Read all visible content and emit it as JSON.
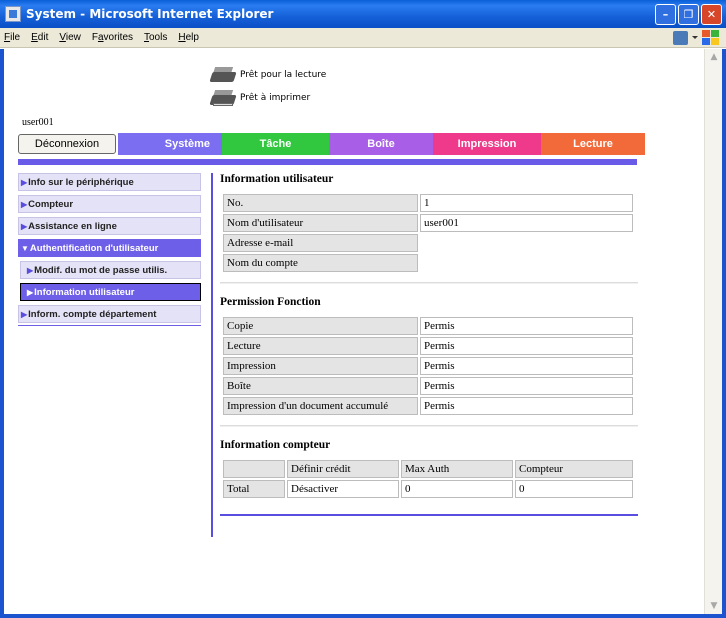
{
  "window": {
    "title": "System - Microsoft Internet Explorer",
    "controls": [
      "minimize",
      "maximize",
      "close"
    ]
  },
  "menubar": {
    "items": [
      {
        "pre": "",
        "key": "F",
        "post": "ile"
      },
      {
        "pre": "",
        "key": "E",
        "post": "dit"
      },
      {
        "pre": "",
        "key": "V",
        "post": "iew"
      },
      {
        "pre": "F",
        "key": "a",
        "post": "vorites"
      },
      {
        "pre": "",
        "key": "T",
        "post": "ools"
      },
      {
        "pre": "",
        "key": "H",
        "post": "elp"
      }
    ]
  },
  "status": {
    "scan": "Prêt pour la lecture",
    "print": "Prêt à imprimer"
  },
  "user": "user001",
  "tabs": {
    "logout": "Déconnexion",
    "systeme": "Système",
    "tache": "Tâche",
    "boite": "Boîte",
    "impression": "Impression",
    "lecture": "Lecture"
  },
  "sidebar": {
    "items": [
      {
        "label": "Info sur le périphérique"
      },
      {
        "label": "Compteur"
      },
      {
        "label": "Assistance en ligne"
      },
      {
        "label": "Authentification d'utilisateur"
      },
      {
        "label": "Modif. du mot de passe utilis."
      },
      {
        "label": "Information utilisateur"
      },
      {
        "label": "Inform. compte département"
      }
    ]
  },
  "user_info": {
    "title": "Information utilisateur",
    "rows": [
      {
        "label": "No.",
        "value": "1"
      },
      {
        "label": "Nom d'utilisateur",
        "value": "user001"
      },
      {
        "label": "Adresse e-mail",
        "value": ""
      },
      {
        "label": "Nom du compte",
        "value": ""
      }
    ]
  },
  "permissions": {
    "title": "Permission Fonction",
    "rows": [
      {
        "label": "Copie",
        "value": "Permis"
      },
      {
        "label": "Lecture",
        "value": "Permis"
      },
      {
        "label": "Impression",
        "value": "Permis"
      },
      {
        "label": "Boîte",
        "value": "Permis"
      },
      {
        "label": "Impression d'un document accumulé",
        "value": "Permis"
      }
    ]
  },
  "counter": {
    "title": "Information compteur",
    "headers": [
      "",
      "Définir crédit",
      "Max Auth",
      "Compteur"
    ],
    "row": {
      "label": "Total",
      "credit": "Désactiver",
      "max": "0",
      "count": "0"
    }
  },
  "colors": {
    "systeme": "#7b6ef0",
    "tache": "#31c83f",
    "boite": "#a85ee6",
    "impression": "#ef3a8b",
    "lecture": "#f36a3a"
  }
}
